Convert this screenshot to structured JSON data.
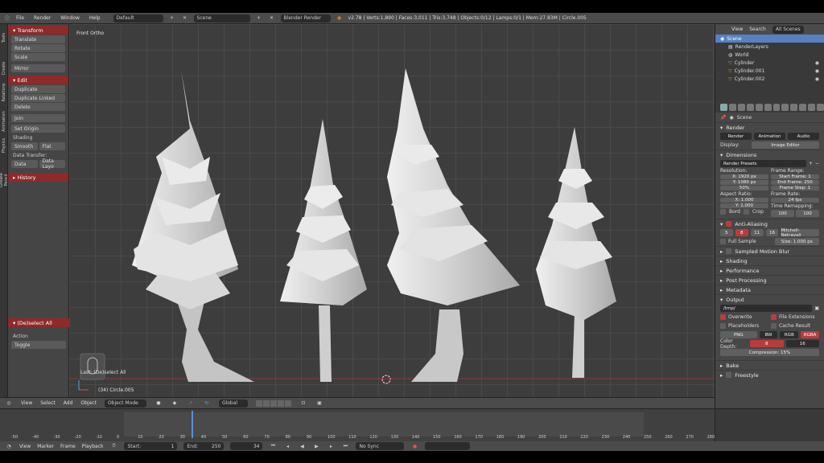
{
  "topbar": {
    "menu": [
      "File",
      "Render",
      "Window",
      "Help"
    ],
    "screen_layout": "Default",
    "scene": "Scene",
    "engine": "Blender Render",
    "stats": "v2.78 | Verts:1,890 | Faces:3,011 | Tris:3,748 | Objects:0/12 | Lamps:0/1 | Mem:27.83M | Circle.005"
  },
  "side_tabs": [
    "Tools",
    "Create",
    "Relations",
    "Animation",
    "Physics",
    "Grease Pencil"
  ],
  "tools": {
    "transform": {
      "header": "Transform",
      "buttons": [
        "Translate",
        "Rotate",
        "Scale",
        "Mirror"
      ]
    },
    "edit": {
      "header": "Edit",
      "buttons": [
        "Duplicate",
        "Duplicate Linked",
        "Delete",
        "Join",
        "Set Origin"
      ],
      "shading_label": "Shading",
      "smooth": "Smooth",
      "flat": "Flat",
      "data_transfer_label": "Data Transfer:",
      "data": "Data",
      "data_layo": "Data Layo"
    },
    "history": {
      "header": "History"
    },
    "operator": {
      "header": "(De)select All",
      "action_label": "Action",
      "action_value": "Toggle"
    }
  },
  "viewport": {
    "view_label": "Front Ortho",
    "last_op": "Last: (De)select All",
    "object_label": "(34) Circle.005"
  },
  "viewport_header": {
    "items": [
      "View",
      "Select",
      "Add",
      "Object"
    ],
    "mode": "Object Mode",
    "orientation": "Global"
  },
  "outliner": {
    "tabs": [
      "View",
      "Search",
      "All Scenes"
    ],
    "items": [
      "Scene",
      "RenderLayers",
      "World",
      "Cylinder",
      "Cylinder.001",
      "Cylinder.002"
    ]
  },
  "properties": {
    "crumb": "Scene",
    "render": {
      "header": "Render",
      "render_btn": "Render",
      "animation_btn": "Animation",
      "audio_btn": "Audio",
      "display_label": "Display:",
      "display_value": "Image Editor"
    },
    "dimensions": {
      "header": "Dimensions",
      "presets": "Render Presets",
      "resolution_label": "Resolution:",
      "res_x": "X:  1920 px",
      "res_y": "Y:  1080 px",
      "res_pct": "50%",
      "frame_range_label": "Frame Range:",
      "start_frame": "Start Frame:  1",
      "end_frame": "End Frame:  250",
      "frame_step": "Frame Step:  1",
      "aspect_label": "Aspect Ratio:",
      "asp_x": "X:  1.000",
      "asp_y": "Y:  1.000",
      "frame_rate_label": "Frame Rate:",
      "fps": "24 fps",
      "remap_label": "Time Remapping:",
      "remap_old": "100",
      "remap_new": "100",
      "bord": "Bord",
      "crop": "Crop"
    },
    "aa": {
      "header": "Anti-Aliasing",
      "samples": [
        "5",
        "8",
        "11",
        "16"
      ],
      "filter": "Mitchell-Netravali",
      "full_sample": "Full Sample",
      "size": "Size:  1.000 px"
    },
    "sections": [
      "Sampled Motion Blur",
      "Shading",
      "Performance",
      "Post Processing",
      "Metadata"
    ],
    "output": {
      "header": "Output",
      "path": "/tmp/",
      "overwrite": "Overwrite",
      "file_ext": "File Extensions",
      "placeholders": "Placeholders",
      "cache_result": "Cache Result",
      "format": "PNG",
      "bw": "BW",
      "rgb": "RGB",
      "rgba": "RGBA",
      "color_depth_label": "Color Depth:",
      "depth_8": "8",
      "depth_16": "16",
      "compression": "Compression:  15%"
    },
    "bake": "Bake",
    "freestyle": "Freestyle"
  },
  "timeline": {
    "ruler": [
      "-50",
      "-40",
      "-30",
      "-20",
      "-10",
      "0",
      "10",
      "20",
      "30",
      "40",
      "50",
      "60",
      "70",
      "80",
      "90",
      "100",
      "110",
      "120",
      "130",
      "140",
      "150",
      "160",
      "170",
      "180",
      "190",
      "200",
      "210",
      "220",
      "230",
      "240",
      "250",
      "260",
      "270",
      "280"
    ],
    "items": [
      "View",
      "Marker",
      "Frame",
      "Playback"
    ],
    "start": "Start:",
    "start_val": "1",
    "end": "End:",
    "end_val": "250",
    "current": "34",
    "sync": "No Sync"
  },
  "colors": {
    "accent": "#8d2a2a",
    "selection": "#5680c2",
    "toggle_on": "#b93c3c"
  }
}
